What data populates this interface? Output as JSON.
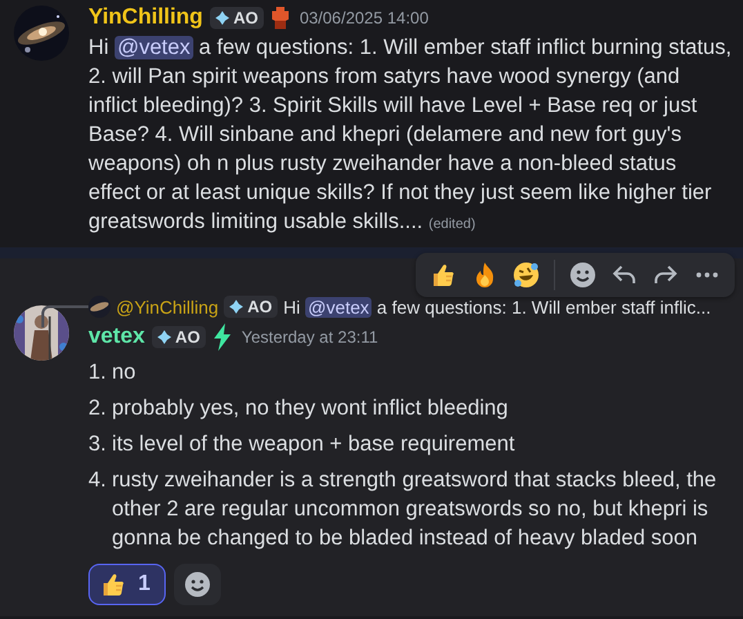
{
  "messages": [
    {
      "author": "YinChilling",
      "color": "#f0c419",
      "tag": "AO",
      "role_icon": {
        "kind": "helmet"
      },
      "timestamp": "03/06/2025 14:00",
      "content": [
        {
          "kind": "text",
          "text": "Hi "
        },
        {
          "kind": "mention",
          "text": "@vetex"
        },
        {
          "kind": "text",
          "text": " a few questions: 1. Will ember staff inflict burning status, 2. will Pan spirit weapons from satyrs have wood synergy (and inflict bleeding)?  3. Spirit Skills will have Level + Base req or just Base? 4. Will sinbane and khepri (delamere and new fort guy's weapons) oh n plus rusty zweihander have a non-bleed status effect or at least unique skills? If not they just seem like higher tier greatswords limiting usable skills.... "
        }
      ],
      "edited": "(edited)"
    },
    {
      "author": "vetex",
      "color": "#5ee6a8",
      "tag": "AO",
      "role_icon": {
        "kind": "bolt"
      },
      "timestamp": "Yesterday at 23:11",
      "hovered": true,
      "reply": {
        "author": "@YinChilling",
        "tag": "AO",
        "content": [
          {
            "kind": "text",
            "text": "Hi "
          },
          {
            "kind": "mention",
            "text": "@vetex"
          },
          {
            "kind": "text",
            "text": " a few questions: 1. Will ember staff inflic..."
          }
        ]
      },
      "items": [
        {
          "number": "1.",
          "text": "no"
        },
        {
          "number": "2.",
          "text": "probably yes, no they wont inflict bleeding"
        },
        {
          "number": "3.",
          "text": "its level of the weapon + base requirement"
        },
        {
          "number": "4.",
          "text": "rusty zweihander is a strength greatsword that stacks bleed, the other 2 are regular uncommon greatswords so no, but khepri is gonna be changed to be bladed instead of heavy bladed soon"
        }
      ],
      "reactions": [
        {
          "kind": "thumbs",
          "count": "1",
          "selected": true
        }
      ]
    }
  ]
}
